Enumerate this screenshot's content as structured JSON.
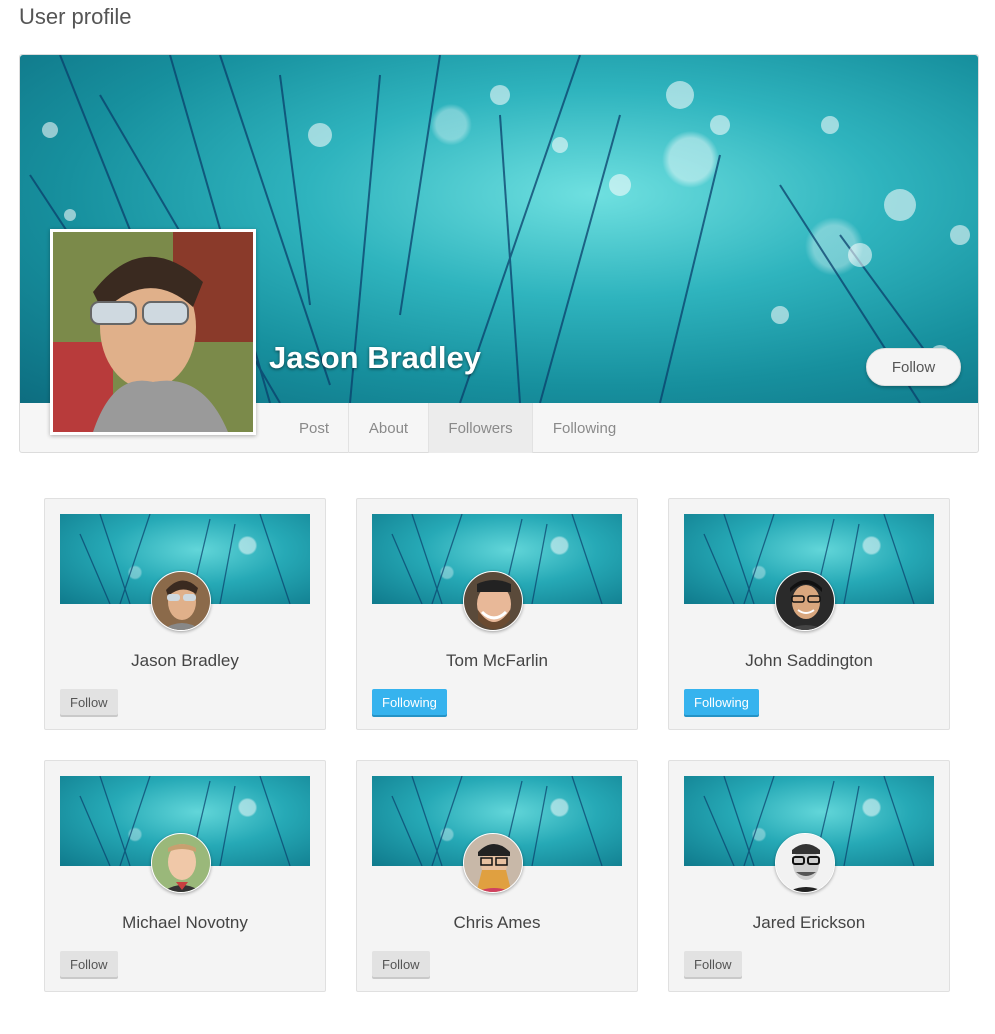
{
  "page": {
    "title": "User profile"
  },
  "profile": {
    "name": "Jason Bradley",
    "follow_label": "Follow",
    "avatar_icon": "person-photo-icon"
  },
  "tabs": [
    {
      "label": "Post",
      "active": false
    },
    {
      "label": "About",
      "active": false
    },
    {
      "label": "Followers",
      "active": true
    },
    {
      "label": "Following",
      "active": false
    }
  ],
  "followers": [
    {
      "name": "Jason Bradley",
      "button": "Follow",
      "state": "follow"
    },
    {
      "name": "Tom McFarlin",
      "button": "Following",
      "state": "following"
    },
    {
      "name": "John Saddington",
      "button": "Following",
      "state": "following"
    },
    {
      "name": "Michael Novotny",
      "button": "Follow",
      "state": "follow"
    },
    {
      "name": "Chris Ames",
      "button": "Follow",
      "state": "follow"
    },
    {
      "name": "Jared Erickson",
      "button": "Follow",
      "state": "follow"
    }
  ],
  "colors": {
    "accent": "#36b3ee",
    "cover": "#2fb4be",
    "follow_button": "#e2e2e2"
  }
}
